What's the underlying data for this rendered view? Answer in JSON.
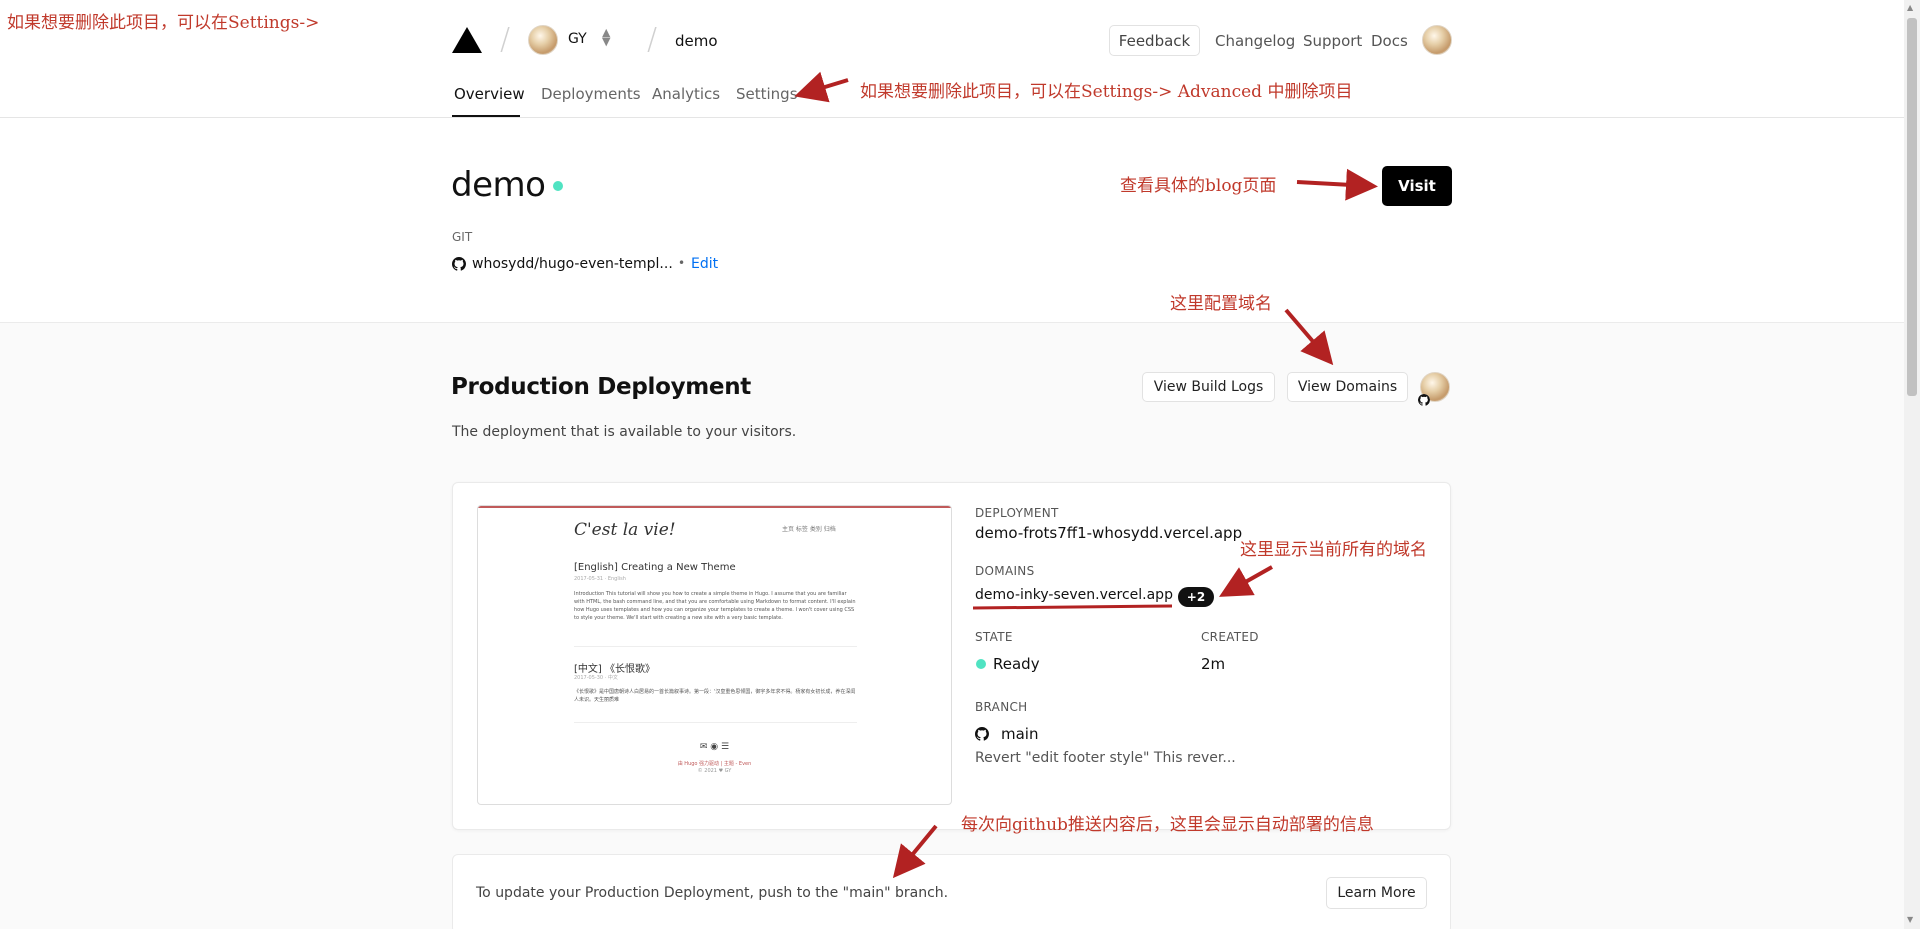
{
  "annotations": {
    "top_left": "如果想要删除此项目，可以在Settings->",
    "settings": "如果想要删除此项目，可以在Settings->  Advanced 中删除项目",
    "visit": "查看具体的blog页面",
    "domains_config": "这里配置域名",
    "all_domains": "这里显示当前所有的域名",
    "auto_deploy": "每次向github推送内容后，这里会显示自动部署的信息"
  },
  "header": {
    "team": "GY",
    "project": "demo",
    "feedback": "Feedback",
    "links": [
      "Changelog",
      "Support",
      "Docs"
    ]
  },
  "tabs": [
    "Overview",
    "Deployments",
    "Analytics",
    "Settings"
  ],
  "project": {
    "title": "demo",
    "visit": "Visit",
    "git_label": "GIT",
    "repo": "whosydd/hugo-even-templ...",
    "bullet": "•",
    "edit": "Edit"
  },
  "production": {
    "title": "Production Deployment",
    "description": "The deployment that is available to your visitors.",
    "view_build_logs": "View Build Logs",
    "view_domains": "View Domains",
    "deployment_label": "DEPLOYMENT",
    "deployment_url": "demo-frots7ff1-whosydd.vercel.app",
    "domains_label": "DOMAINS",
    "domain": "demo-inky-seven.vercel.app",
    "domains_more": "+2",
    "state_label": "STATE",
    "state": "Ready",
    "created_label": "CREATED",
    "created": "2m",
    "branch_label": "BRANCH",
    "branch": "main",
    "commit": "Revert \"edit footer style\" This rever..."
  },
  "preview": {
    "site_title": "C'est la vie!",
    "nav": "主页  标签  类别  归档",
    "post1_title": "[English] Creating a New Theme",
    "post1_meta": "2017-05-31 · English",
    "post1_text": "Introduction This tutorial will show you how to create a simple theme in Hugo. I assume that you are familiar with HTML, the bash command line, and that you are comfortable using Markdown to format content. I'll explain how Hugo uses templates and how you can organize your templates to create a theme. I won't cover using CSS to style your theme. We'll start with creating a new site with a very basic template.",
    "post2_title": "[中文] 《长恨歌》",
    "post2_meta": "2017-05-30 · 中文",
    "post2_text": "《长恨歌》是中国唐朝诗人白居易的一首长篇叙事诗。第一段：'汉皇重色思倾国，御宇多年求不得。杨家有女初长成，养在深闺人未识。天生丽质难",
    "footer_line1": "由 Hugo 强力驱动 | 主题 - Even",
    "footer_line2": "© 2021 ♥ GY"
  },
  "update": {
    "text": "To update your Production Deployment, push to the \"main\" branch.",
    "learn_more": "Learn More"
  },
  "colors": {
    "accent_blue": "#0070f3",
    "ready": "#50e3c2",
    "annotation": "#c0392b"
  }
}
